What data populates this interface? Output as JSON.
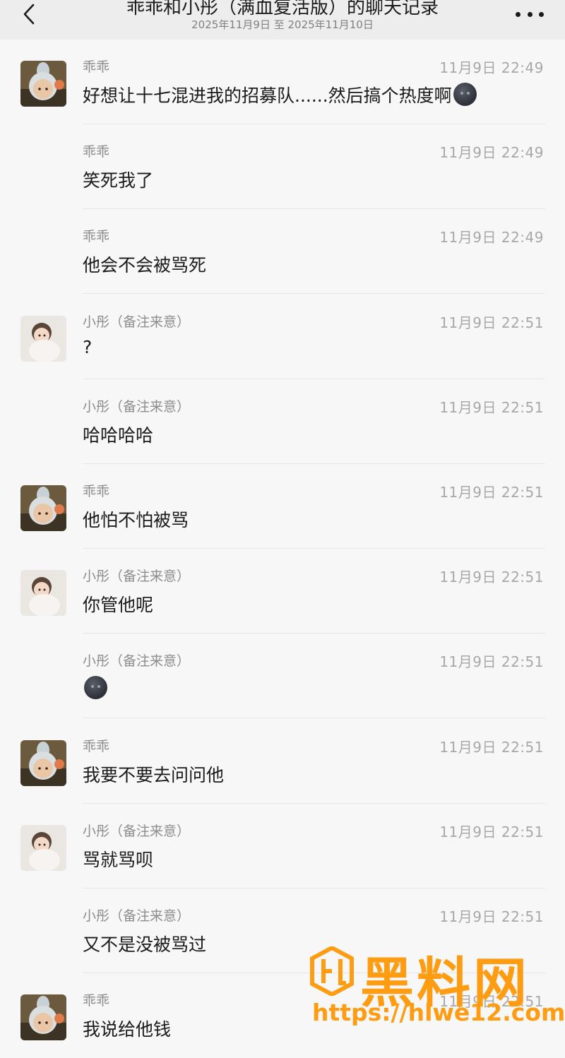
{
  "header": {
    "title": "乖乖和小彤（满血复活版）的聊天记录",
    "subtitle": "2025年11月9日 至 2025年11月10日"
  },
  "messages": [
    {
      "sender": "乖乖",
      "time": "11月9日 22:49",
      "text": "好想让十七混进我的招募队......然后搞个热度啊",
      "emoji": true,
      "avatar": "guaiguai"
    },
    {
      "sender": "乖乖",
      "time": "11月9日 22:49",
      "text": "笑死我了",
      "emoji": false,
      "avatar": ""
    },
    {
      "sender": "乖乖",
      "time": "11月9日 22:49",
      "text": "他会不会被骂死",
      "emoji": false,
      "avatar": ""
    },
    {
      "sender": "小彤（备注来意）",
      "time": "11月9日 22:51",
      "text": "?",
      "emoji": false,
      "avatar": "xiaotong"
    },
    {
      "sender": "小彤（备注来意）",
      "time": "11月9日 22:51",
      "text": "哈哈哈哈",
      "emoji": false,
      "avatar": ""
    },
    {
      "sender": "乖乖",
      "time": "11月9日 22:51",
      "text": "他怕不怕被骂",
      "emoji": false,
      "avatar": "guaiguai"
    },
    {
      "sender": "小彤（备注来意）",
      "time": "11月9日 22:51",
      "text": "你管他呢",
      "emoji": false,
      "avatar": "xiaotong"
    },
    {
      "sender": "小彤（备注来意）",
      "time": "11月9日 22:51",
      "text": "",
      "emoji": true,
      "avatar": ""
    },
    {
      "sender": "乖乖",
      "time": "11月9日 22:51",
      "text": "我要不要去问问他",
      "emoji": false,
      "avatar": "guaiguai"
    },
    {
      "sender": "小彤（备注来意）",
      "time": "11月9日 22:51",
      "text": "骂就骂呗",
      "emoji": false,
      "avatar": "xiaotong"
    },
    {
      "sender": "小彤（备注来意）",
      "time": "11月9日 22:51",
      "text": "又不是没被骂过",
      "emoji": false,
      "avatar": ""
    },
    {
      "sender": "乖乖",
      "time": "11月9日 22:51",
      "text": "我说给他钱",
      "emoji": false,
      "avatar": "guaiguai"
    }
  ],
  "watermark": {
    "name": "黑料网",
    "url": "https://hlwe12.com"
  },
  "colors": {
    "accent_watermark": "#ff9c12",
    "header_bg": "#ededed",
    "page_bg": "#f7f7f7"
  },
  "icons": {
    "back": "chevron-left-icon",
    "more": "more-dots-icon",
    "emoji": "dark-face-emoji-icon"
  }
}
